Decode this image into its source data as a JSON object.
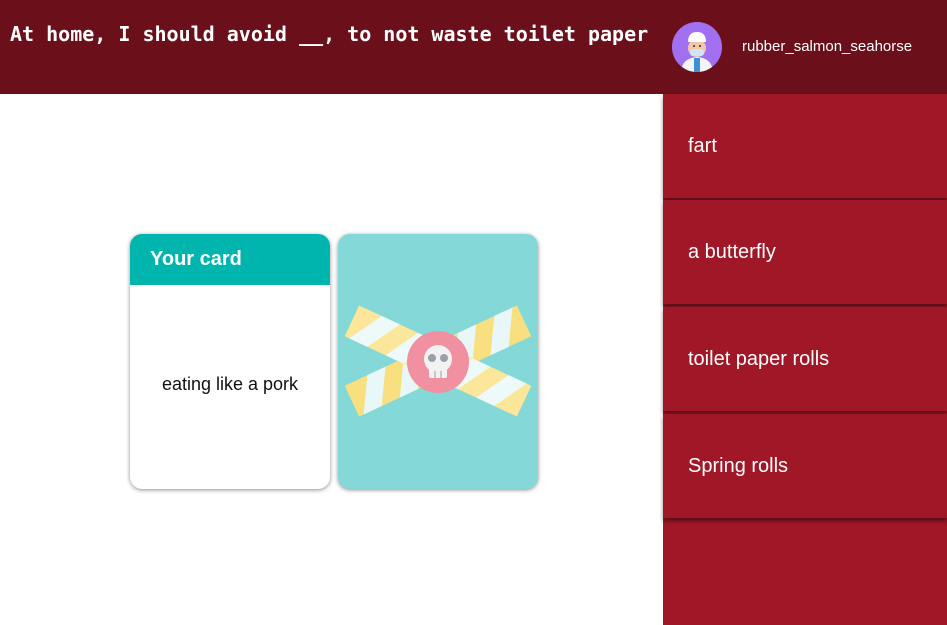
{
  "header": {
    "prompt": "At home, I should avoid __, to not waste toilet paper",
    "username": "rubber_salmon_seahorse",
    "avatar_icon": "doctor-avatar"
  },
  "hand": {
    "card_heading": "Your card",
    "card_text": "eating like a pork",
    "back_icon": "skull-tape-icon"
  },
  "options": [
    {
      "label": "fart"
    },
    {
      "label": "a butterfly"
    },
    {
      "label": "toilet paper rolls"
    },
    {
      "label": "Spring rolls"
    }
  ],
  "colors": {
    "header_bg": "#6b101b",
    "sidebar_bg": "#a01727",
    "card_head": "#00b5ad",
    "card_back": "#84d9d8"
  }
}
